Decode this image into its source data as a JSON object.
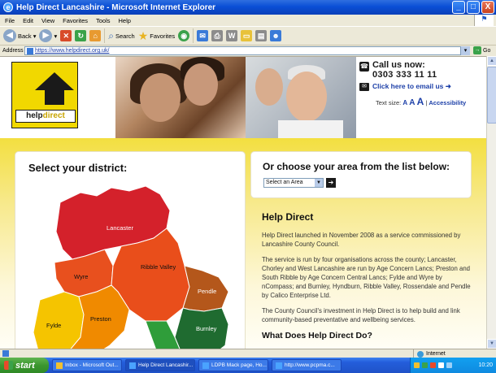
{
  "window": {
    "title": "Help Direct Lancashire - Microsoft Internet Explorer",
    "buttons": [
      "_",
      "□",
      "X"
    ]
  },
  "menubar": {
    "items": [
      "File",
      "Edit",
      "View",
      "Favorites",
      "Tools",
      "Help"
    ]
  },
  "toolbar": {
    "back_label": "Back",
    "search_label": "Search",
    "favorites_label": "Favorites"
  },
  "address": {
    "label": "Address",
    "url": "https://www.helpdirect.org.uk/",
    "go_label": "Go"
  },
  "header": {
    "logo_word_1": "help",
    "logo_word_2": "direct",
    "call_label": "Call us now:",
    "phone": "0303 333 11 11",
    "email_link": "Click here to email us",
    "email_arrow": "➜",
    "text_size_label": "Text size:",
    "text_size_a": [
      "A",
      "A",
      "A"
    ],
    "accessibility_link": "Accessibility"
  },
  "district": {
    "title": "Select your district:",
    "regions": [
      "Lancaster",
      "Wyre",
      "Ribble Valley",
      "Pendle",
      "Fylde",
      "Preston",
      "Burnley"
    ]
  },
  "area": {
    "title": "Or choose your area from the list below:",
    "select_value": "Select an Area",
    "go_symbol": "➔"
  },
  "info": {
    "heading": "Help Direct",
    "paragraphs": [
      "Help Direct launched in November 2008 as a service commissioned by Lancashire County Council.",
      "The service is run by four organisations across the county; Lancaster, Chorley and West Lancashire are run by Age Concern Lancs; Preston and South Ribble by Age Concern Central Lancs; Fylde and Wyre by nCompass; and Burnley, Hyndburn, Ribble Valley, Rossendale and Pendle by Calico Enterprise Ltd.",
      "The County Council's investment in Help Direct is to help build and link community-based preventative and wellbeing services."
    ],
    "subheading": "What Does Help Direct Do?"
  },
  "statusbar": {
    "zone": "Internet"
  },
  "taskbar": {
    "start_label": "start",
    "tasks": [
      "Inbox - Microsoft Out...",
      "Help Direct Lancashir...",
      "LDPB Mack page, Ho...",
      "http://www.pcpma.c..."
    ],
    "clock": "10:20"
  },
  "colors": {
    "lancaster": "#d4212b",
    "wyre": "#e8501e",
    "ribble_valley": "#e94e1b",
    "pendle": "#b4571b",
    "fylde": "#f5c400",
    "preston": "#f08a00",
    "burnley": "#1f6b30",
    "brand_yellow": "#f1d800"
  }
}
